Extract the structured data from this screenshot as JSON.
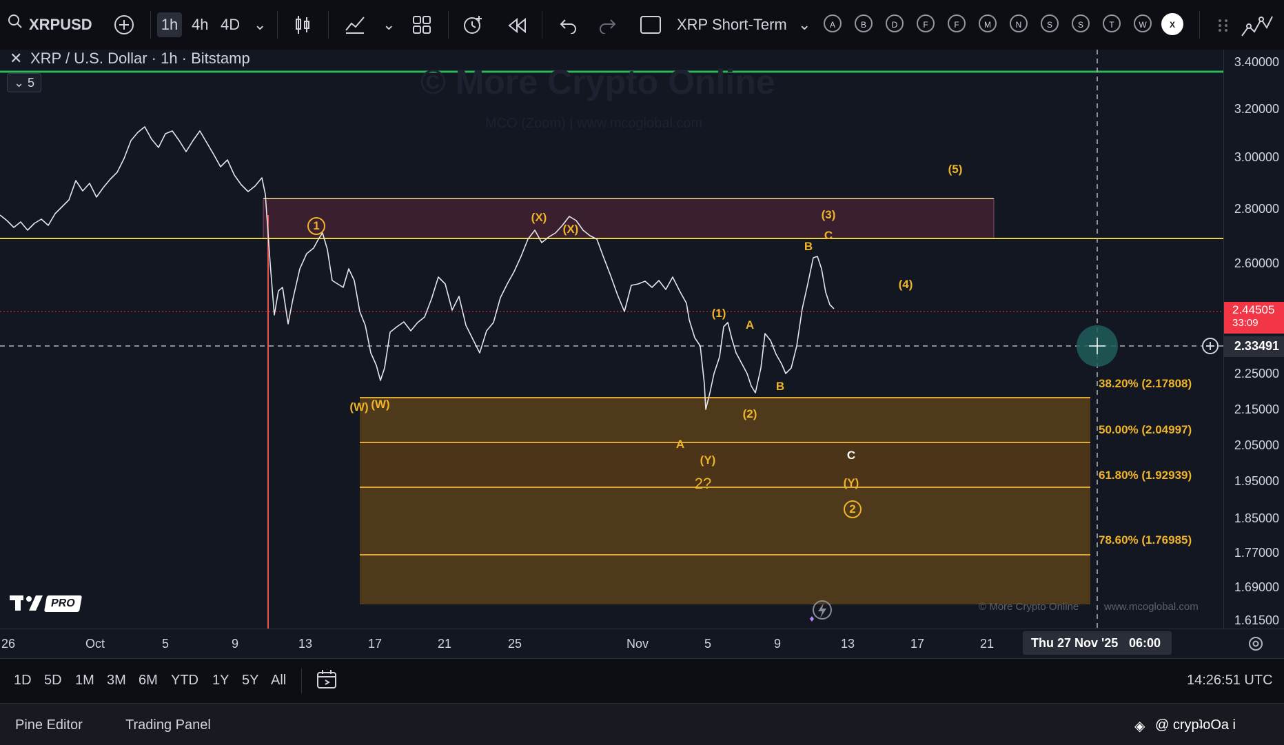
{
  "toolbar": {
    "symbol": "XRPUSD",
    "intervals": [
      "1h",
      "4h",
      "4D"
    ],
    "layout_name": "XRP Short-Term",
    "alert_letters": [
      "A",
      "B",
      "D",
      "F",
      "F",
      "M",
      "N",
      "S",
      "S",
      "T",
      "W",
      "X"
    ]
  },
  "legend": {
    "title": "XRP / U.S. Dollar · 1h · Bitstamp",
    "collapse_count": "5"
  },
  "watermark": {
    "line1": "© More Crypto Online",
    "line2": "MCO (Zoom)  |  www.mcoglobal.com",
    "bottom_left": "© More Crypto Online",
    "bottom_right": "www.mcoglobal.com"
  },
  "price_axis": {
    "labels": [
      "3.40000",
      "3.20000",
      "3.00000",
      "2.80000",
      "2.60000",
      "2.25000",
      "2.15000",
      "2.05000",
      "1.95000",
      "1.85000",
      "1.77000",
      "1.69000",
      "1.61500"
    ],
    "current_price": "2.44505",
    "countdown": "33:09",
    "crosshair_price": "2.33491"
  },
  "time_axis": {
    "labels": [
      "26",
      "Oct",
      "5",
      "9",
      "13",
      "17",
      "21",
      "25",
      "Nov",
      "5",
      "9",
      "13",
      "17",
      "21"
    ],
    "crosshair_time": "Thu 27 Nov '25",
    "crosshair_clock": "06:00"
  },
  "fib_levels": [
    {
      "label": "38.20% (2.17808)"
    },
    {
      "label": "50.00% (2.04997)"
    },
    {
      "label": "61.80% (1.92939)"
    },
    {
      "label": "78.60% (1.76985)"
    }
  ],
  "wave_labels": [
    {
      "text": "(X)"
    },
    {
      "text": "(X)"
    },
    {
      "text": "(5)"
    },
    {
      "text": "(3)"
    },
    {
      "text": "B"
    },
    {
      "text": "C"
    },
    {
      "text": "(4)"
    },
    {
      "text": "(1)"
    },
    {
      "text": "A"
    },
    {
      "text": "B"
    },
    {
      "text": "(2)"
    },
    {
      "text": "(W)"
    },
    {
      "text": "(W)"
    },
    {
      "text": "A"
    },
    {
      "text": "(Y)"
    },
    {
      "text": "2?"
    },
    {
      "text": "C"
    },
    {
      "text": "(Y)"
    }
  ],
  "circled_labels": [
    {
      "text": "1"
    },
    {
      "text": "2"
    }
  ],
  "logo": {
    "badge": "PRO"
  },
  "bottom": {
    "ranges": [
      "1D",
      "5D",
      "1M",
      "3M",
      "6M",
      "YTD",
      "1Y",
      "5Y",
      "All"
    ],
    "clock": "14:26:51 UTC"
  },
  "panels": {
    "pine": "Pine Editor",
    "trading": "Trading Panel",
    "credit": "@ crypʇoOa i"
  },
  "colors": {
    "green_line": "#2fb85a",
    "yellow_line": "#e8d44d",
    "zone_top": "#3a1f2e",
    "fib_zone": "#5a3f1a",
    "label_orange": "#f0b429",
    "price_red": "#f23645",
    "bull": "#26a69a",
    "bear": "#ef5350"
  }
}
